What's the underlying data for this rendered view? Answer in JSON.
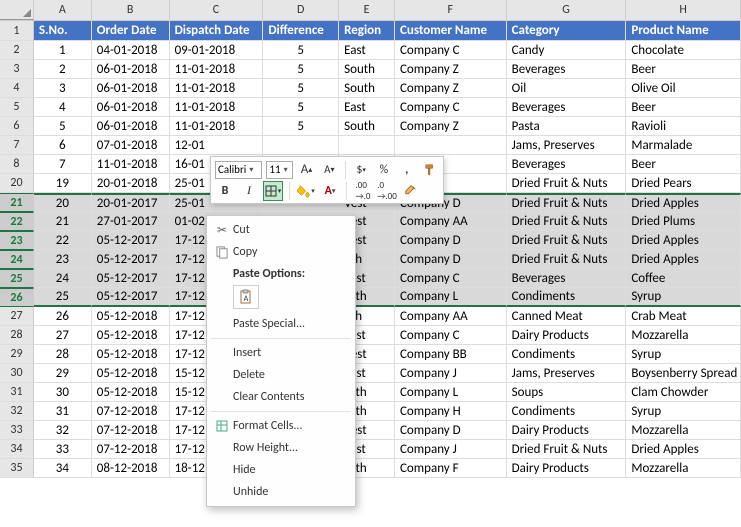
{
  "columns": [
    "A",
    "B",
    "C",
    "D",
    "E",
    "F",
    "G",
    "H"
  ],
  "headers": {
    "A": "S.No.",
    "B": "Order Date",
    "C": "Dispatch Date",
    "D": "Difference",
    "E": "Region",
    "F": "Customer Name",
    "G": "Category",
    "H": "Product Name"
  },
  "rows": [
    {
      "n": 2,
      "sel": false,
      "A": "1",
      "B": "04-01-2018",
      "C": "09-01-2018",
      "D": "5",
      "E": "East",
      "F": "Company C",
      "G": "Candy",
      "H": "Chocolate"
    },
    {
      "n": 3,
      "sel": false,
      "A": "2",
      "B": "06-01-2018",
      "C": "11-01-2018",
      "D": "5",
      "E": "South",
      "F": "Company Z",
      "G": "Beverages",
      "H": "Beer"
    },
    {
      "n": 4,
      "sel": false,
      "A": "3",
      "B": "06-01-2018",
      "C": "11-01-2018",
      "D": "5",
      "E": "South",
      "F": "Company Z",
      "G": "Oil",
      "H": "Olive Oil"
    },
    {
      "n": 5,
      "sel": false,
      "A": "4",
      "B": "06-01-2018",
      "C": "11-01-2018",
      "D": "5",
      "E": "East",
      "F": "Company C",
      "G": "Beverages",
      "H": "Beer"
    },
    {
      "n": 6,
      "sel": false,
      "A": "5",
      "B": "06-01-2018",
      "C": "11-01-2018",
      "D": "5",
      "E": "South",
      "F": "Company Z",
      "G": "Pasta",
      "H": "Ravioli"
    },
    {
      "n": 7,
      "sel": false,
      "A": "6",
      "B": "07-01-2018",
      "C": "12-01",
      "D": "",
      "E": "",
      "F": "",
      "G": "Jams, Preserves",
      "H": "Marmalade"
    },
    {
      "n": 8,
      "sel": false,
      "A": "7",
      "B": "11-01-2018",
      "C": "16-01",
      "D": "",
      "E": "",
      "F": "",
      "G": "Beverages",
      "H": "Beer"
    },
    {
      "n": 20,
      "sel": false,
      "A": "19",
      "B": "20-01-2018",
      "C": "25-01",
      "D": "",
      "E": "",
      "F": "",
      "G": "Dried Fruit & Nuts",
      "H": "Dried Pears"
    },
    {
      "n": 21,
      "sel": true,
      "A": "20",
      "B": "20-01-2017",
      "C": "25-01",
      "D": "",
      "E": "Vest",
      "F": "Company D",
      "G": "Dried Fruit & Nuts",
      "H": "Dried Apples"
    },
    {
      "n": 22,
      "sel": true,
      "A": "21",
      "B": "27-01-2017",
      "C": "01-02",
      "D": "",
      "E": "Vest",
      "F": "Company AA",
      "G": "Dried Fruit & Nuts",
      "H": "Dried Plums"
    },
    {
      "n": 23,
      "sel": true,
      "A": "22",
      "B": "05-12-2017",
      "C": "17-12",
      "D": "",
      "E": "Vest",
      "F": "Company D",
      "G": "Dried Fruit & Nuts",
      "H": "Dried Apples"
    },
    {
      "n": 24,
      "sel": true,
      "A": "23",
      "B": "05-12-2017",
      "C": "17-12",
      "D": "",
      "E": "uth",
      "F": "Company D",
      "G": "Dried Fruit & Nuts",
      "H": "Dried Apples"
    },
    {
      "n": 25,
      "sel": true,
      "A": "24",
      "B": "05-12-2017",
      "C": "17-12",
      "D": "",
      "E": "East",
      "F": "Company C",
      "G": "Beverages",
      "H": "Coffee"
    },
    {
      "n": 26,
      "sel": true,
      "A": "25",
      "B": "05-12-2017",
      "C": "17-12",
      "D": "",
      "E": "orth",
      "F": "Company L",
      "G": "Condiments",
      "H": "Syrup"
    },
    {
      "n": 27,
      "sel": false,
      "A": "26",
      "B": "05-12-2018",
      "C": "17-12",
      "D": "",
      "E": "uth",
      "F": "Company AA",
      "G": "Canned Meat",
      "H": "Crab Meat"
    },
    {
      "n": 28,
      "sel": false,
      "A": "27",
      "B": "05-12-2018",
      "C": "17-12",
      "D": "",
      "E": "East",
      "F": "Company C",
      "G": "Dairy Products",
      "H": "Mozzarella"
    },
    {
      "n": 29,
      "sel": false,
      "A": "28",
      "B": "05-12-2018",
      "C": "17-12",
      "D": "",
      "E": "Vest",
      "F": "Company BB",
      "G": "Condiments",
      "H": "Syrup"
    },
    {
      "n": 30,
      "sel": false,
      "A": "29",
      "B": "05-12-2018",
      "C": "15-12",
      "D": "",
      "E": "East",
      "F": "Company J",
      "G": "Jams, Preserves",
      "H": "Boysenberry Spread"
    },
    {
      "n": 31,
      "sel": false,
      "A": "30",
      "B": "05-12-2018",
      "C": "15-12",
      "D": "",
      "E": "orth",
      "F": "Company L",
      "G": "Soups",
      "H": "Clam Chowder"
    },
    {
      "n": 32,
      "sel": false,
      "A": "31",
      "B": "07-12-2018",
      "C": "17-12",
      "D": "",
      "E": "orth",
      "F": "Company H",
      "G": "Condiments",
      "H": "Syrup"
    },
    {
      "n": 33,
      "sel": false,
      "A": "32",
      "B": "07-12-2018",
      "C": "17-12",
      "D": "",
      "E": "Vest",
      "F": "Company D",
      "G": "Dairy Products",
      "H": "Mozzarella"
    },
    {
      "n": 34,
      "sel": false,
      "A": "33",
      "B": "07-12-2018",
      "C": "17-12",
      "D": "",
      "E": "East",
      "F": "Company J",
      "G": "Dried Fruit & Nuts",
      "H": "Dried Apples"
    },
    {
      "n": 35,
      "sel": false,
      "A": "34",
      "B": "08-12-2018",
      "C": "18-12",
      "D": "",
      "E": "orth",
      "F": "Company F",
      "G": "Dairy Products",
      "H": "Mozzarella"
    }
  ],
  "mini_toolbar": {
    "font": "Calibri",
    "size": "11",
    "btns": {
      "grow": "A",
      "shrink": "A",
      "percent": "%",
      "comma": ",",
      "bold": "B",
      "italic": "I"
    }
  },
  "context_menu": {
    "cut": "Cut",
    "copy": "Copy",
    "paste_heading": "Paste Options:",
    "paste_special": "Paste Special...",
    "insert": "Insert",
    "delete": "Delete",
    "clear": "Clear Contents",
    "format": "Format Cells...",
    "rowheight": "Row Height...",
    "hide": "Hide",
    "unhide": "Unhide"
  }
}
